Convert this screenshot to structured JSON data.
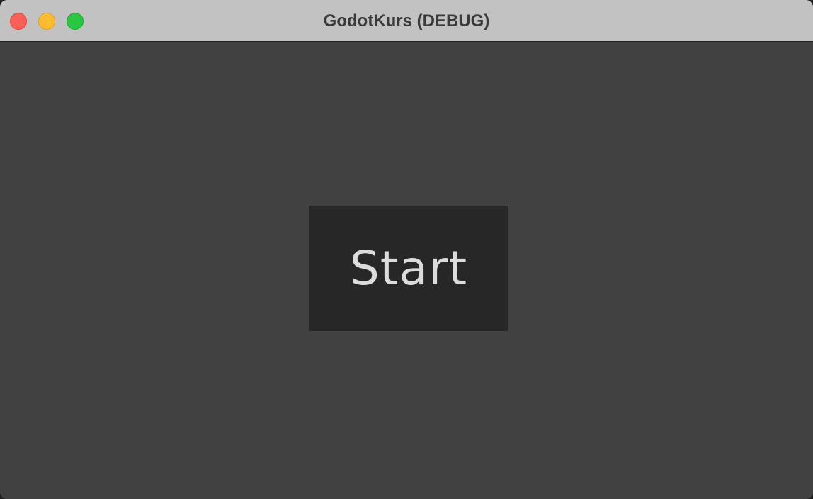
{
  "window": {
    "title": "GodotKurs (DEBUG)",
    "controls": {
      "close_icon": "close-icon",
      "minimize_icon": "minimize-icon",
      "zoom_icon": "zoom-icon",
      "close_color": "#fe5f57",
      "minimize_color": "#febc2e",
      "zoom_color": "#28c840"
    }
  },
  "scene": {
    "background_color": "#414141",
    "start_button": {
      "label": "Start",
      "background_color": "#272727",
      "text_color": "#dcdcdc"
    }
  }
}
